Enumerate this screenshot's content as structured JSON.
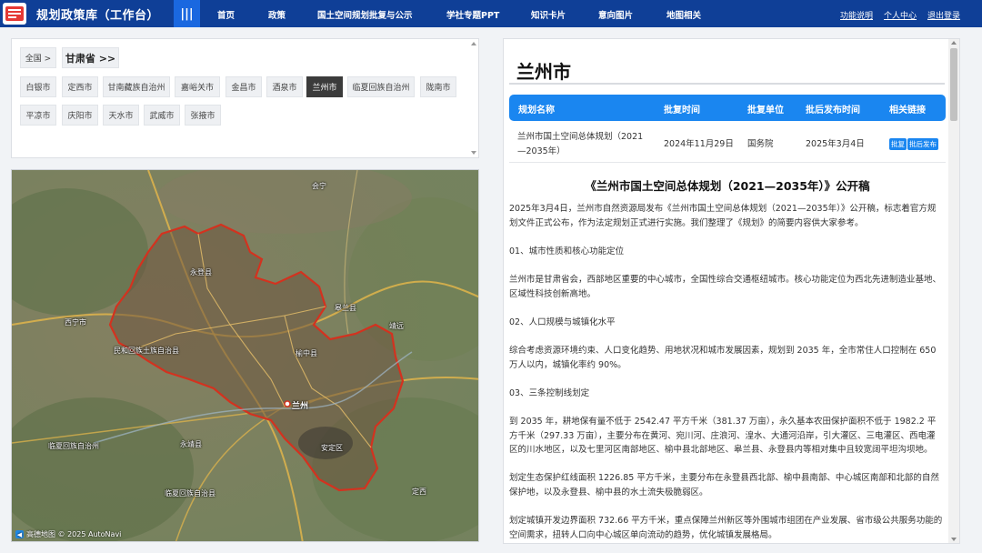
{
  "header": {
    "app_title": "规划政策库（工作台）",
    "menu_icon": "|||",
    "nav": [
      "首页",
      "政策",
      "国土空间规划批复与公示",
      "学社专题PPT",
      "知识卡片",
      "意向图片",
      "地图相关"
    ],
    "links": [
      "功能说明",
      "个人中心",
      "退出登录"
    ]
  },
  "filter": {
    "country": "全国 >",
    "province": "甘肃省 >>",
    "cities": [
      "白银市",
      "定西市",
      "甘南藏族自治州",
      "嘉峪关市",
      "金昌市",
      "酒泉市",
      "兰州市",
      "临夏回族自治州",
      "陇南市",
      "平凉市",
      "庆阳市",
      "天水市",
      "武威市",
      "张掖市"
    ],
    "selected": "兰州市"
  },
  "map": {
    "labels": [
      "永登县",
      "皋兰县",
      "榆中县",
      "兰州",
      "西宁市",
      "民和回族土族自治县",
      "临夏回族自治州",
      "临夏回族自治县",
      "永靖县",
      "定西",
      "安定区",
      "靖远",
      "会宁"
    ],
    "attribution": "高德地图 © 2025 AutoNavi"
  },
  "detail": {
    "city": "兰州市",
    "table_headers": [
      "规划名称",
      "批复时间",
      "批复单位",
      "批后发布时间",
      "相关链接"
    ],
    "row": {
      "name_line1": "兰州市国土空间总体规划（2021",
      "name_line2": "—2035年）",
      "approve_date": "2024年11月29日",
      "approve_unit": "国务院",
      "publish_date": "2025年3月4日",
      "link1": "批复",
      "link2": "批后发布"
    },
    "article_title": "《兰州市国土空间总体规划（2021—2035年）》公开稿",
    "paragraphs": [
      "2025年3月4日，兰州市自然资源局发布《兰州市国土空间总体规划（2021—2035年）》公开稿，标志着官方规划文件正式公布，作为法定规划正式进行实施。我们整理了《规划》的简要内容供大家参考。",
      "01、城市性质和核心功能定位",
      "兰州市是甘肃省会，西部地区重要的中心城市，全国性综合交通枢纽城市。核心功能定位为西北先进制造业基地、区域性科技创新高地。",
      "02、人口规模与城镇化水平",
      "综合考虑资源环境约束、人口变化趋势、用地状况和城市发展因素，规划到 2035 年，全市常住人口控制在 650 万人以内，城镇化率约 90%。",
      "03、三条控制线划定",
      "到 2035 年，耕地保有量不低于 2542.47 平方千米（381.37 万亩），永久基本农田保护面积不低于 1982.2 平方千米（297.33 万亩），主要分布在黄河、宛川河、庄浪河、湟水、大通河沿岸，引大灌区、三电灌区、西电灌区的川水地区，以及七里河区南部地区、榆中县北部地区、皋兰县、永登县内等相对集中且较宽阔平坦沟坝地。",
      "划定生态保护红线面积 1226.85 平方千米，主要分布在永登县西北部、榆中县南部、中心城区南部和北部的自然保护地，以及永登县、榆中县的水土流失极脆弱区。",
      "划定城镇开发边界面积 732.66 平方千米，重点保障兰州新区等外围城市组团在产业发展、省市级公共服务功能的空间需求，扭转人口向中心城区单向流动的趋势，优化城镇发展格局。"
    ]
  }
}
